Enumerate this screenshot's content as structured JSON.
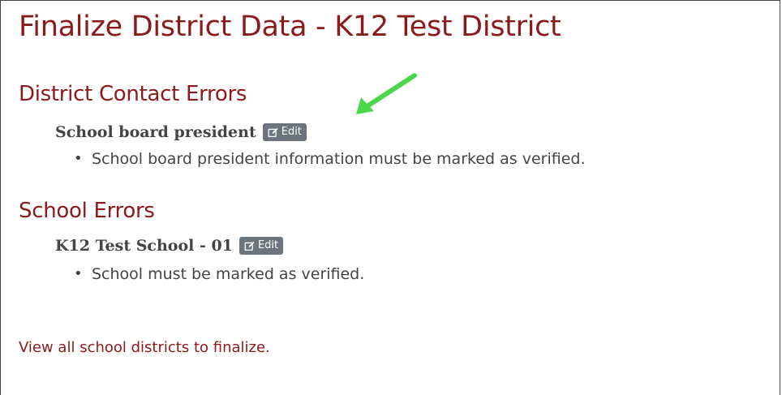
{
  "page_title": "Finalize District Data - K12 Test District",
  "sections": [
    {
      "title": "District Contact Errors",
      "item_name": "School board president",
      "edit_label": "Edit",
      "errors": [
        "School board president information must be marked as verified."
      ]
    },
    {
      "title": "School Errors",
      "item_name": "K12 Test School - 01",
      "edit_label": "Edit",
      "errors": [
        "School must be marked as verified."
      ]
    }
  ],
  "footer_link": "View all school districts to finalize.",
  "colors": {
    "title": "#8b1a1a",
    "edit_button": "#6c757d",
    "annotation_arrow": "#4cd64c"
  },
  "icons": [
    "edit-icon",
    "annotation-arrow"
  ]
}
